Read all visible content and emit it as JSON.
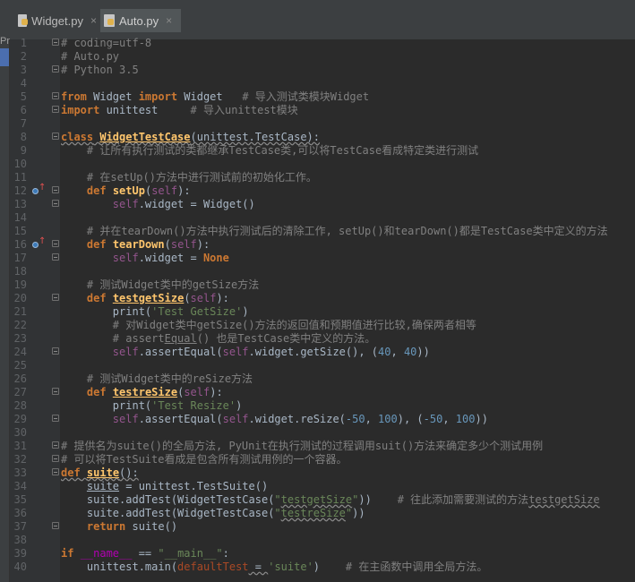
{
  "tabs": [
    {
      "label": "Widget.py",
      "active": false
    },
    {
      "label": "Auto.py",
      "active": true
    }
  ],
  "left_strip_label": "Pr",
  "close_glyph": "×",
  "line_numbers": [
    "1",
    "2",
    "3",
    "4",
    "5",
    "6",
    "7",
    "8",
    "9",
    "10",
    "11",
    "12",
    "13",
    "14",
    "15",
    "16",
    "17",
    "18",
    "19",
    "20",
    "21",
    "22",
    "23",
    "24",
    "25",
    "26",
    "27",
    "28",
    "29",
    "30",
    "31",
    "32",
    "33",
    "34",
    "35",
    "36",
    "37",
    "38",
    "39",
    "40"
  ],
  "code": {
    "l1": "# coding=utf-8",
    "l2": "# Auto.py",
    "l3": "# Python 3.5",
    "l5_from": "from",
    "l5_mod": " Widget ",
    "l5_import": "import",
    "l5_name": " Widget   ",
    "l5_comment": "# 导入测试类模块Widget",
    "l6_import": "import",
    "l6_mod": " unittest     ",
    "l6_comment": "# 导入unittest模块",
    "l8_class": "class",
    "l8_name": "WidgetTestCase",
    "l8_base": "(unittest.TestCase):",
    "l9": "    # 让所有执行测试的类都继承TestCase类,可以将TestCase看成特定类进行测试",
    "l11": "    # 在setUp()方法中进行测试前的初始化工作。",
    "l12_def": "def",
    "l12_name": "setUp",
    "l12_open": "(",
    "l12_self": "self",
    "l12_close": "):",
    "l13_self": "self",
    "l13_rest": ".widget = Widget()",
    "l15": "    # 并在tearDown()方法中执行测试后的清除工作, setUp()和tearDown()都是TestCase类中定义的方法",
    "l16_def": "def",
    "l16_name": "tearDown",
    "l16_open": "(",
    "l16_self": "self",
    "l16_close": "):",
    "l17_self": "self",
    "l17_rest": ".widget = ",
    "l17_none": "None",
    "l19": "    # 测试Widget类中的getSize方法",
    "l20_def": "def",
    "l20_name": "testgetSize",
    "l20_open": "(",
    "l20_self": "self",
    "l20_close": "):",
    "l21_print": "print(",
    "l21_str": "'Test GetSize'",
    "l21_close": ")",
    "l22": "        # 对Widget类中getSize()方法的返回值和预期值进行比较,确保两者相等",
    "l23_a": "        # assert",
    "l23_b": "Equal",
    "l23_c": "() 也是TestCase类中定义的方法。",
    "l24_self": "self",
    "l24_mid": ".assertEqual(",
    "l24_self2": "self",
    "l24_rest": ".widget.getSize(), (",
    "l24_n1": "40",
    "l24_comma": ", ",
    "l24_n2": "40",
    "l24_end": "))",
    "l26": "    # 测试Widget类中的reSize方法",
    "l27_def": "def",
    "l27_name": "testreSize",
    "l27_open": "(",
    "l27_self": "self",
    "l27_close": "):",
    "l28_print": "print(",
    "l28_str": "'Test Resize'",
    "l28_close": ")",
    "l29_self": "self",
    "l29_mid": ".assertEqual(",
    "l29_self2": "self",
    "l29_rest": ".widget.reSize(",
    "l29_n1": "-50",
    "l29_comma": ", ",
    "l29_n2": "100",
    "l29_mid2": "), (",
    "l29_n3": "-50",
    "l29_comma2": ", ",
    "l29_n4": "100",
    "l29_end": "))",
    "l31": "# 提供名为suite()的全局方法, PyUnit在执行测试的过程调用suit()方法来确定多少个测试用例",
    "l32": "# 可以将TestSuite看成是包含所有测试用例的一个容器。",
    "l33_def": "def",
    "l33_name": "suite",
    "l33_close": "():",
    "l34_pre": "    ",
    "l34_var": "suite",
    "l34_rest": " = unittest.TestSuite()",
    "l35_a": "    suite.addTest(WidgetTestCase(",
    "l35_q1": "\"",
    "l35_str": "testgetSize",
    "l35_q2": "\"",
    "l35_b": "))    ",
    "l35_cmt1": "# 往此添加需要测试的方法",
    "l35_cmt2": "testgetSize",
    "l36_a": "    suite.addTest(WidgetTestCase(",
    "l36_q1": "\"",
    "l36_str": "testreSize",
    "l36_q2": "\"",
    "l36_b": "))",
    "l37_ret": "return",
    "l37_rest": " suite()",
    "l39_if": "if",
    "l39_sp": " ",
    "l39_name": "__name__",
    "l39_eq": " == ",
    "l39_str": "\"__main__\"",
    "l39_colon": ":",
    "l40_a": "    unittest.main(",
    "l40_param": "defaultTest",
    "l40_eq": " = ",
    "l40_str": "'suite'",
    "l40_b": ")    ",
    "l40_cmt": "# 在主函数中调用全局方法。"
  },
  "colors": {
    "background": "#2b2b2b",
    "keyword": "#cc7832",
    "comment": "#808080",
    "string": "#6a8759",
    "number": "#6897bb",
    "self": "#94558d",
    "function": "#ffc66d"
  }
}
